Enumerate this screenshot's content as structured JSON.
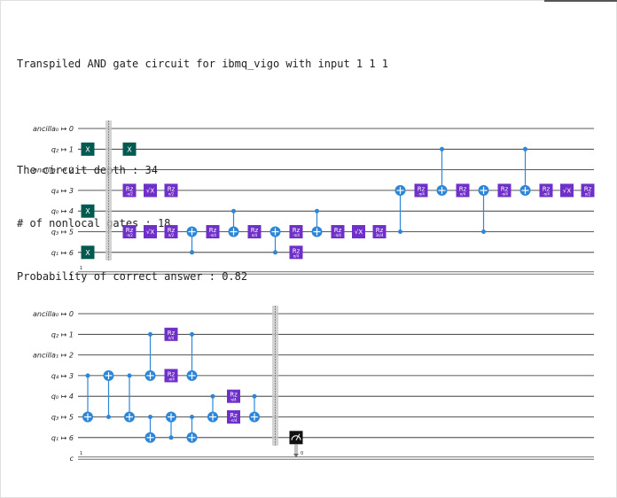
{
  "output": {
    "title": "Transpiled AND gate circuit for ibmq_vigo with input 1 1 1",
    "depth_line": "The circuit depth : 34",
    "nonlocal_line": "# of nonlocal gates : 18",
    "prob_line": "Probability of correct answer : 0.82"
  },
  "circuit": {
    "wire_labels": [
      "ancilla₀ ↦ 0",
      "q₂ ↦ 1",
      "ancilla₁ ↦ 2",
      "q₄ ↦ 3",
      "q₀ ↦ 4",
      "q₃ ↦ 5",
      "q₁ ↦ 6"
    ],
    "classical_label": "c",
    "classical_bits": "1",
    "measure_bit": "0",
    "x_label": "X",
    "sx_label": "√X",
    "rz_label": "Rz",
    "colors": {
      "x": "#005a50",
      "purple": "#6f2fc9",
      "cnot": "#2d86d8",
      "barrier": "#c8c8c8",
      "measure": "#111111",
      "wire": "#222222"
    },
    "rows": [
      {
        "gates": [
          {
            "t": "x",
            "q": 1,
            "c": 0
          },
          {
            "t": "x",
            "q": 4,
            "c": 0
          },
          {
            "t": "x",
            "q": 6,
            "c": 0
          },
          {
            "t": "barrier",
            "c": 1
          },
          {
            "t": "x",
            "q": 1,
            "c": 2
          },
          {
            "t": "rz",
            "q": 3,
            "c": 2,
            "p": "-π/2"
          },
          {
            "t": "sx",
            "q": 3,
            "c": 3
          },
          {
            "t": "rz",
            "q": 3,
            "c": 4,
            "p": "π/2"
          },
          {
            "t": "rz",
            "q": 5,
            "c": 2,
            "p": "-π/2"
          },
          {
            "t": "sx",
            "q": 5,
            "c": 3
          },
          {
            "t": "rz",
            "q": 5,
            "c": 4,
            "p": "π/2"
          },
          {
            "t": "cx",
            "ctl": 6,
            "tgt": 5,
            "c": 5
          },
          {
            "t": "rz",
            "q": 5,
            "c": 6,
            "p": "-π/4"
          },
          {
            "t": "cx",
            "ctl": 4,
            "tgt": 5,
            "c": 7
          },
          {
            "t": "rz",
            "q": 5,
            "c": 8,
            "p": "π/4"
          },
          {
            "t": "cx",
            "ctl": 6,
            "tgt": 5,
            "c": 9
          },
          {
            "t": "rz",
            "q": 5,
            "c": 10,
            "p": "-π/4"
          },
          {
            "t": "rz",
            "q": 6,
            "c": 10,
            "p": "π/4"
          },
          {
            "t": "cx",
            "ctl": 4,
            "tgt": 5,
            "c": 11
          },
          {
            "t": "rz",
            "q": 5,
            "c": 12,
            "p": "-π/4"
          },
          {
            "t": "sx",
            "q": 5,
            "c": 13
          },
          {
            "t": "rz",
            "q": 5,
            "c": 14,
            "p": "3π/4"
          },
          {
            "t": "cx",
            "ctl": 5,
            "tgt": 3,
            "c": 15
          },
          {
            "t": "rz",
            "q": 3,
            "c": 16,
            "p": "-π/4"
          },
          {
            "t": "cx",
            "ctl": 1,
            "tgt": 3,
            "c": 17
          },
          {
            "t": "rz",
            "q": 3,
            "c": 18,
            "p": "π/4"
          },
          {
            "t": "cx",
            "ctl": 5,
            "tgt": 3,
            "c": 19
          },
          {
            "t": "rz",
            "q": 3,
            "c": 20,
            "p": "-π/4"
          },
          {
            "t": "cx",
            "ctl": 1,
            "tgt": 3,
            "c": 21
          },
          {
            "t": "rz",
            "q": 3,
            "c": 22,
            "p": "-π/4"
          },
          {
            "t": "sx",
            "q": 3,
            "c": 23
          },
          {
            "t": "rz",
            "q": 3,
            "c": 24,
            "p": "π/2"
          }
        ]
      },
      {
        "gates": [
          {
            "t": "cx",
            "ctl": 3,
            "tgt": 5,
            "c": 0
          },
          {
            "t": "cx",
            "ctl": 5,
            "tgt": 3,
            "c": 1
          },
          {
            "t": "cx",
            "ctl": 3,
            "tgt": 5,
            "c": 2
          },
          {
            "t": "cx",
            "ctl": 1,
            "tgt": 3,
            "c": 3
          },
          {
            "t": "cx",
            "ctl": 5,
            "tgt": 6,
            "c": 3
          },
          {
            "t": "rz",
            "q": 1,
            "c": 4,
            "p": "π/4"
          },
          {
            "t": "rz",
            "q": 3,
            "c": 4,
            "p": "-π/4"
          },
          {
            "t": "cx",
            "ctl": 6,
            "tgt": 5,
            "c": 4
          },
          {
            "t": "cx",
            "ctl": 1,
            "tgt": 3,
            "c": 5
          },
          {
            "t": "cx",
            "ctl": 5,
            "tgt": 6,
            "c": 5
          },
          {
            "t": "cx",
            "ctl": 4,
            "tgt": 5,
            "c": 6
          },
          {
            "t": "rz",
            "q": 4,
            "c": 7,
            "p": "π/4"
          },
          {
            "t": "rz",
            "q": 5,
            "c": 7,
            "p": "-π/4"
          },
          {
            "t": "cx",
            "ctl": 4,
            "tgt": 5,
            "c": 8
          },
          {
            "t": "barrier",
            "c": 9
          },
          {
            "t": "measure",
            "q": 6,
            "c": 10
          }
        ]
      }
    ]
  }
}
